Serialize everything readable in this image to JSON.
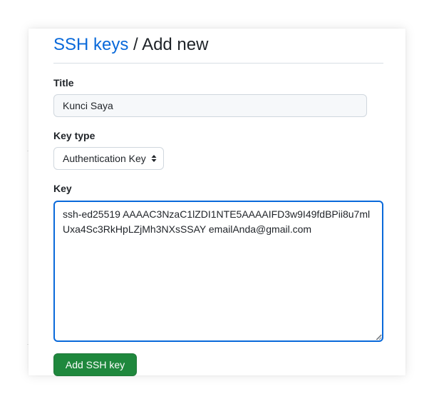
{
  "header": {
    "breadcrumb_link": "SSH keys",
    "separator": "/",
    "current_page": "Add new"
  },
  "form": {
    "title_label": "Title",
    "title_value": "Kunci Saya",
    "key_type_label": "Key type",
    "key_type_selected": "Authentication Key",
    "key_label": "Key",
    "key_value": "ssh-ed25519 AAAAC3NzaC1lZDI1NTE5AAAAIFD3w9I49fdBPii8u7mlUxa4Sc3RkHpLZjMh3NXsSSAY emailAnda@gmail.com",
    "submit_label": "Add SSH key"
  },
  "colors": {
    "link": "#0969da",
    "focus_border": "#0969da",
    "primary_button": "#1f883d"
  },
  "icons": {
    "select_arrows": "select-arrows-icon",
    "resize": "resize-handle-icon"
  }
}
